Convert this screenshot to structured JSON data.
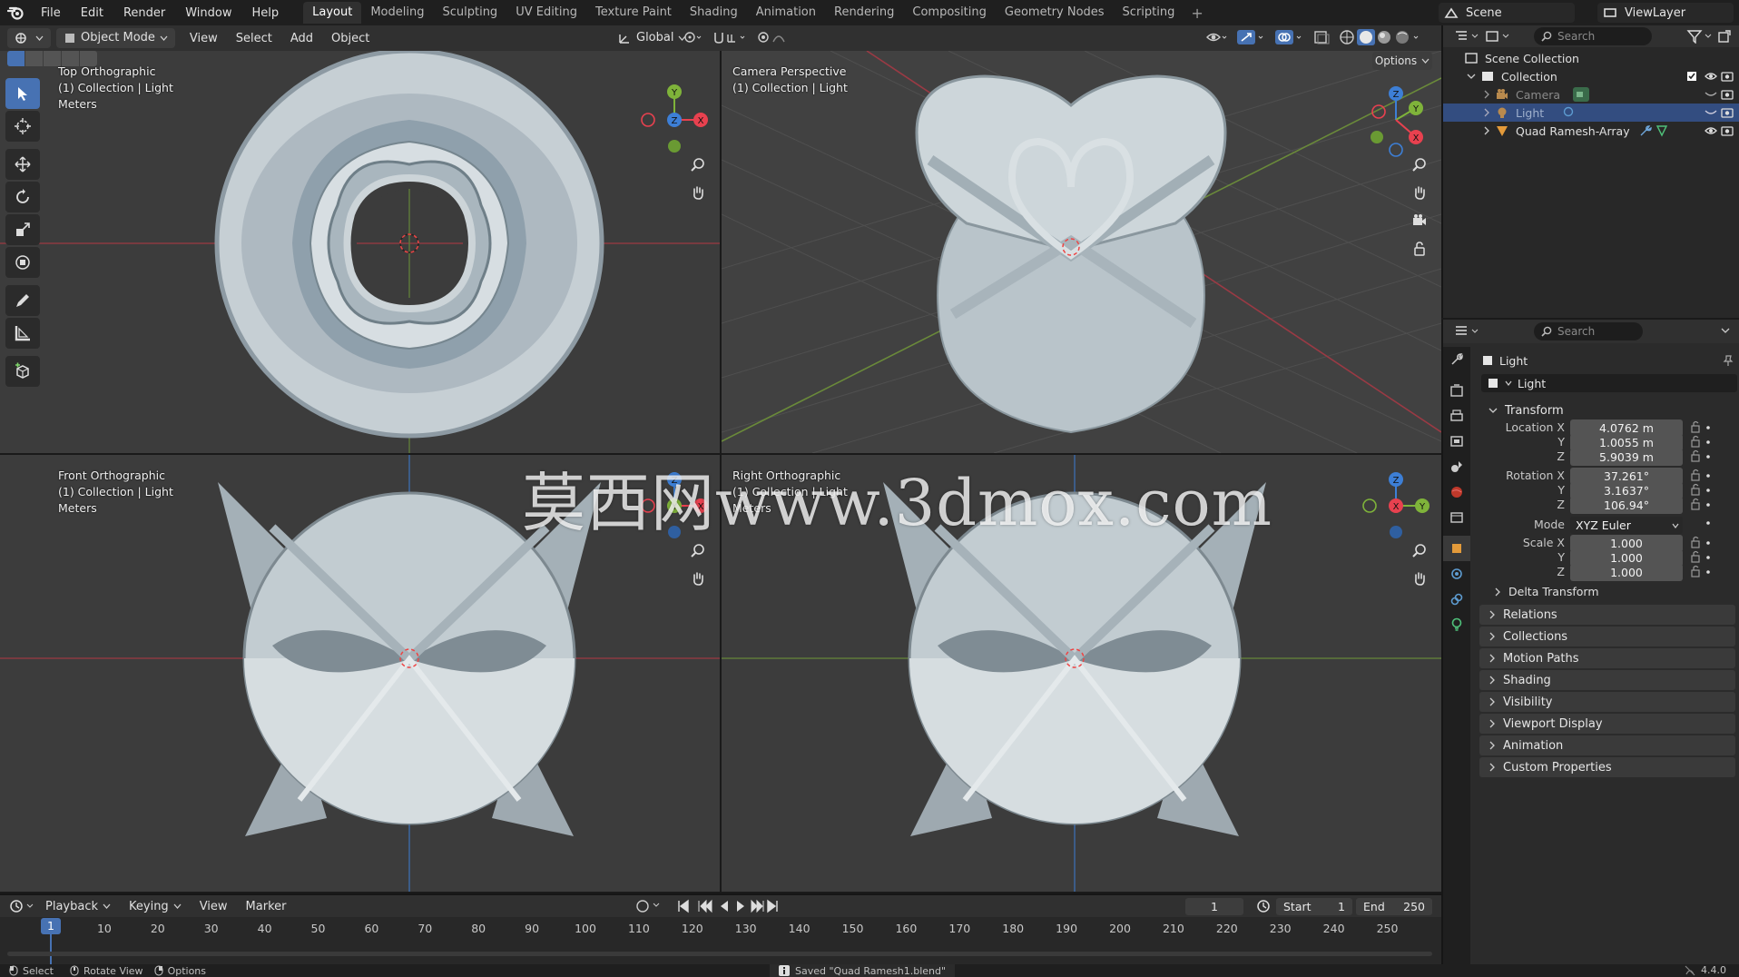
{
  "app": {
    "name": "Blender",
    "version": "4.4.0"
  },
  "menu": [
    "File",
    "Edit",
    "Render",
    "Window",
    "Help"
  ],
  "workspaces": [
    "Layout",
    "Modeling",
    "Sculpting",
    "UV Editing",
    "Texture Paint",
    "Shading",
    "Animation",
    "Rendering",
    "Compositing",
    "Geometry Nodes",
    "Scripting"
  ],
  "active_workspace": "Layout",
  "scene": "Scene",
  "view_layer": "ViewLayer",
  "viewport_header": {
    "mode": "Object Mode",
    "menus": [
      "View",
      "Select",
      "Add",
      "Object"
    ],
    "orientation": "Global",
    "options": "Options"
  },
  "viewports": [
    {
      "title": "Top Orthographic",
      "line2": "(1) Collection | Light",
      "line3": "Meters"
    },
    {
      "title": "Camera Perspective",
      "line2": "(1) Collection | Light",
      "line3": ""
    },
    {
      "title": "Front Orthographic",
      "line2": "(1) Collection | Light",
      "line3": "Meters"
    },
    {
      "title": "Right Orthographic",
      "line2": "(1) Collection | Light",
      "line3": "Meters"
    }
  ],
  "outliner": {
    "search_placeholder": "Search",
    "scene_collection": "Scene Collection",
    "collection": "Collection",
    "items": [
      "Camera",
      "Light",
      "Quad Ramesh-Array"
    ]
  },
  "properties": {
    "search_placeholder": "Search",
    "object_name": "Light",
    "datablock": "Light",
    "transform_label": "Transform",
    "location_label": "Location X",
    "location": [
      "4.0762 m",
      "1.0055 m",
      "5.9039 m"
    ],
    "rotation_label": "Rotation X",
    "rotation": [
      "37.261°",
      "3.1637°",
      "106.94°"
    ],
    "mode_label": "Mode",
    "mode": "XYZ Euler",
    "scale_label": "Scale X",
    "scale": [
      "1.000",
      "1.000",
      "1.000"
    ],
    "axis_y": "Y",
    "axis_z": "Z",
    "delta": "Delta Transform",
    "panels": [
      "Relations",
      "Collections",
      "Motion Paths",
      "Shading",
      "Visibility",
      "Viewport Display",
      "Animation",
      "Custom Properties"
    ]
  },
  "timeline": {
    "menus": [
      "Playback",
      "Keying",
      "View",
      "Marker"
    ],
    "current_frame": "1",
    "start_label": "Start",
    "start": "1",
    "end_label": "End",
    "end": "250",
    "ticks": [
      "1",
      "10",
      "20",
      "30",
      "40",
      "50",
      "60",
      "70",
      "80",
      "90",
      "100",
      "110",
      "120",
      "130",
      "140",
      "150",
      "160",
      "170",
      "180",
      "190",
      "200",
      "210",
      "220",
      "230",
      "240",
      "250"
    ]
  },
  "status": {
    "select": "Select",
    "rotate": "Rotate View",
    "options": "Options",
    "message": "Saved \"Quad Ramesh1.blend\""
  },
  "watermark": "莫西网www.3dmox.com",
  "colors": {
    "accent": "#4772b3",
    "x_axis": "#e8414f",
    "y_axis": "#7fb33a",
    "z_axis": "#3d7fd6"
  }
}
